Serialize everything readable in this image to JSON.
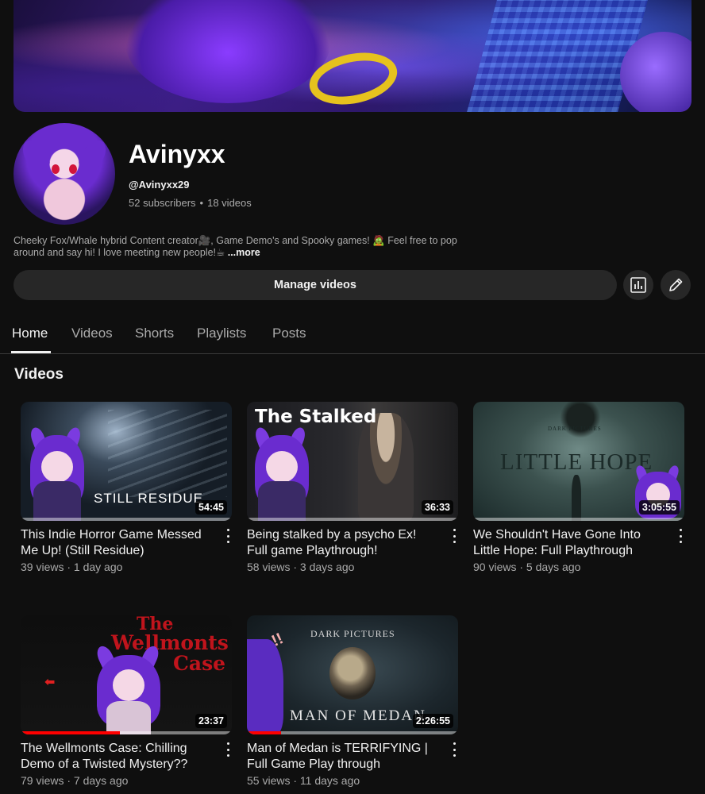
{
  "channel": {
    "name": "Avinyxx",
    "handle": "@Avinyxx29",
    "subscribers": "52 subscribers",
    "videos_count": "18 videos",
    "description_line1": "Cheeky Fox/Whale hybrid Content creator🎥, Game Demo's and Spooky games! 🧟 Feel free to pop",
    "description_line2": "around and say hi! I love meeting new people!☕ ",
    "more_label": "...more"
  },
  "actions": {
    "manage_label": "Manage videos",
    "analytics_icon": "analytics-icon",
    "edit_icon": "pencil-icon"
  },
  "tabs": [
    {
      "label": "Home",
      "active": true
    },
    {
      "label": "Videos",
      "active": false
    },
    {
      "label": "Shorts",
      "active": false
    },
    {
      "label": "Playlists",
      "active": false
    },
    {
      "label": "Posts",
      "active": false
    }
  ],
  "section_title": "Videos",
  "videos": [
    {
      "title_line1": "This Indie Horror Game Messed",
      "title_line2": "Me Up! (Still Residue)",
      "views": "39 views",
      "age": "1 day ago",
      "duration": "54:45",
      "thumb_text": "STILL RESIDUE",
      "progress": 0.0
    },
    {
      "title_line1": "Being stalked by a psycho Ex!",
      "title_line2": "Full game Playthrough!",
      "views": "58 views",
      "age": "3 days ago",
      "duration": "36:33",
      "thumb_text": "The Stalked",
      "progress": 0.0
    },
    {
      "title_line1": "We Shouldn't Have Gone Into",
      "title_line2": "Little Hope: Full Playthrough",
      "views": "90 views",
      "age": "5 days ago",
      "duration": "3:05:55",
      "thumb_text": "LITTLE HOPE",
      "thumb_subtext": "DARK PICTURES",
      "progress": 0.0
    },
    {
      "title_line1": "The Wellmonts Case: Chilling",
      "title_line2": "Demo of a Twisted Mystery??",
      "views": "79 views",
      "age": "7 days ago",
      "duration": "23:37",
      "thumb_text_1": "The",
      "thumb_text_2": "Wellmonts",
      "thumb_text_3": "Case",
      "progress": 0.47
    },
    {
      "title_line1": "Man of Medan is TERRIFYING |",
      "title_line2": "Full Game Play through",
      "views": "55 views",
      "age": "11 days ago",
      "duration": "2:26:55",
      "thumb_text": "MAN OF MEDAN",
      "thumb_subtext": "DARK PICTURES",
      "progress": 0.16
    }
  ],
  "meta_separator": "·"
}
